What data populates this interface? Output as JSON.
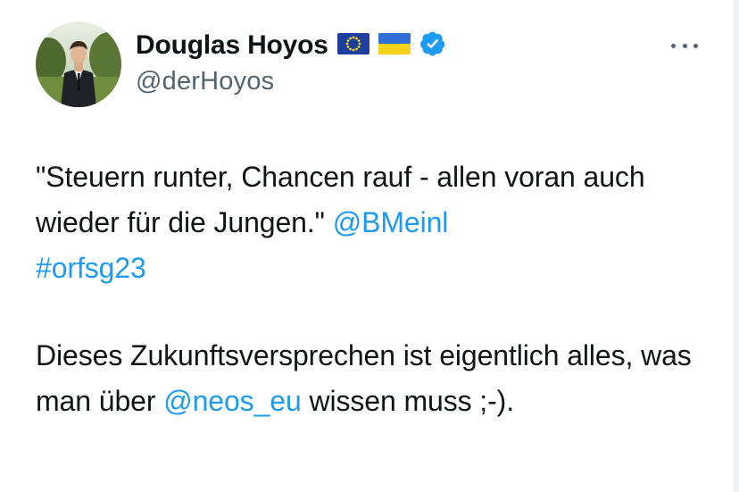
{
  "author": {
    "display_name": "Douglas Hoyos",
    "handle": "@derHoyos",
    "flags": [
      "eu-flag-icon",
      "ukraine-flag-icon"
    ],
    "verified": true
  },
  "tweet": {
    "p1_text": "\"Steuern runter, Chancen rauf - allen voran auch wieder für die Jungen.\"",
    "p1_mention": "@BMeinl",
    "p1_hashtag": "#orfsg23",
    "p2_text_a": "Dieses Zukunftsversprechen ist eigentlich alles, was man über",
    "p2_mention": "@neos_eu",
    "p2_text_b": "wissen muss ;-)."
  },
  "colors": {
    "link": "#1d9bf0",
    "secondary_text": "#536471",
    "verified_badge": "#1d9bf0"
  },
  "icons": {
    "more": "more-dots-icon",
    "verified": "verified-badge-icon"
  }
}
